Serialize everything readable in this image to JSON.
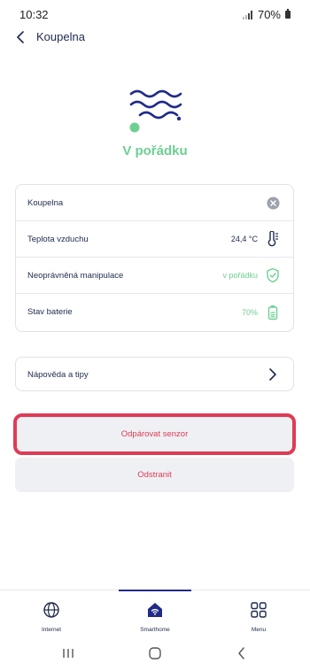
{
  "status_bar": {
    "time": "10:32",
    "battery": "70%"
  },
  "header": {
    "title": "Koupelna"
  },
  "hero": {
    "status": "V pořádku",
    "status_color": "#6ecf93"
  },
  "details": {
    "rows": [
      {
        "label": "Koupelna",
        "value": "",
        "icon": "clear-icon"
      },
      {
        "label": "Teplota vzduchu",
        "value": "24,4 °C",
        "icon": "thermometer-icon"
      },
      {
        "label": "Neoprávněná manipulace",
        "value": "v pořádku",
        "icon": "shield-check-icon"
      },
      {
        "label": "Stav baterie",
        "value": "70%",
        "icon": "battery-icon"
      }
    ]
  },
  "help": {
    "label": "Nápověda a tipy"
  },
  "actions": {
    "unpair": "Odpárovat senzor",
    "remove": "Odstranit"
  },
  "nav": {
    "items": [
      {
        "label": "Internet",
        "icon": "globe-icon"
      },
      {
        "label": "Smarthome",
        "icon": "smarthome-icon"
      },
      {
        "label": "Menu",
        "icon": "grid-icon"
      }
    ],
    "active": "Smarthome"
  },
  "colors": {
    "primary": "#1f2a8a",
    "ok": "#6ecf93",
    "danger": "#e03a55"
  }
}
